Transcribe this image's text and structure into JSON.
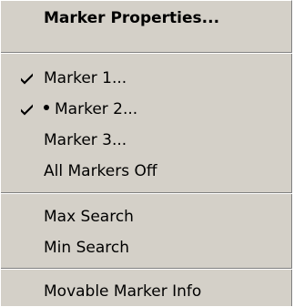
{
  "menu": {
    "items": [
      {
        "label": "Marker Properties...",
        "checked": false,
        "bold": true
      },
      {
        "label": "Marker 1...",
        "checked": true
      },
      {
        "label": "Marker 2...",
        "checked": true,
        "radio_dot": true
      },
      {
        "label": "Marker 3...",
        "checked": false
      },
      {
        "label": "All Markers Off",
        "checked": false
      },
      {
        "label": "Max Search",
        "checked": false
      },
      {
        "label": "Min Search",
        "checked": false
      },
      {
        "label": "Movable Marker Info",
        "checked": false
      }
    ]
  },
  "icons": {
    "check": "check-icon",
    "bullet": "bullet-icon"
  },
  "colors": {
    "menu_bg": "#d4d0c8",
    "separator_dark": "#808080",
    "separator_light": "#ffffff",
    "text": "#000000"
  }
}
